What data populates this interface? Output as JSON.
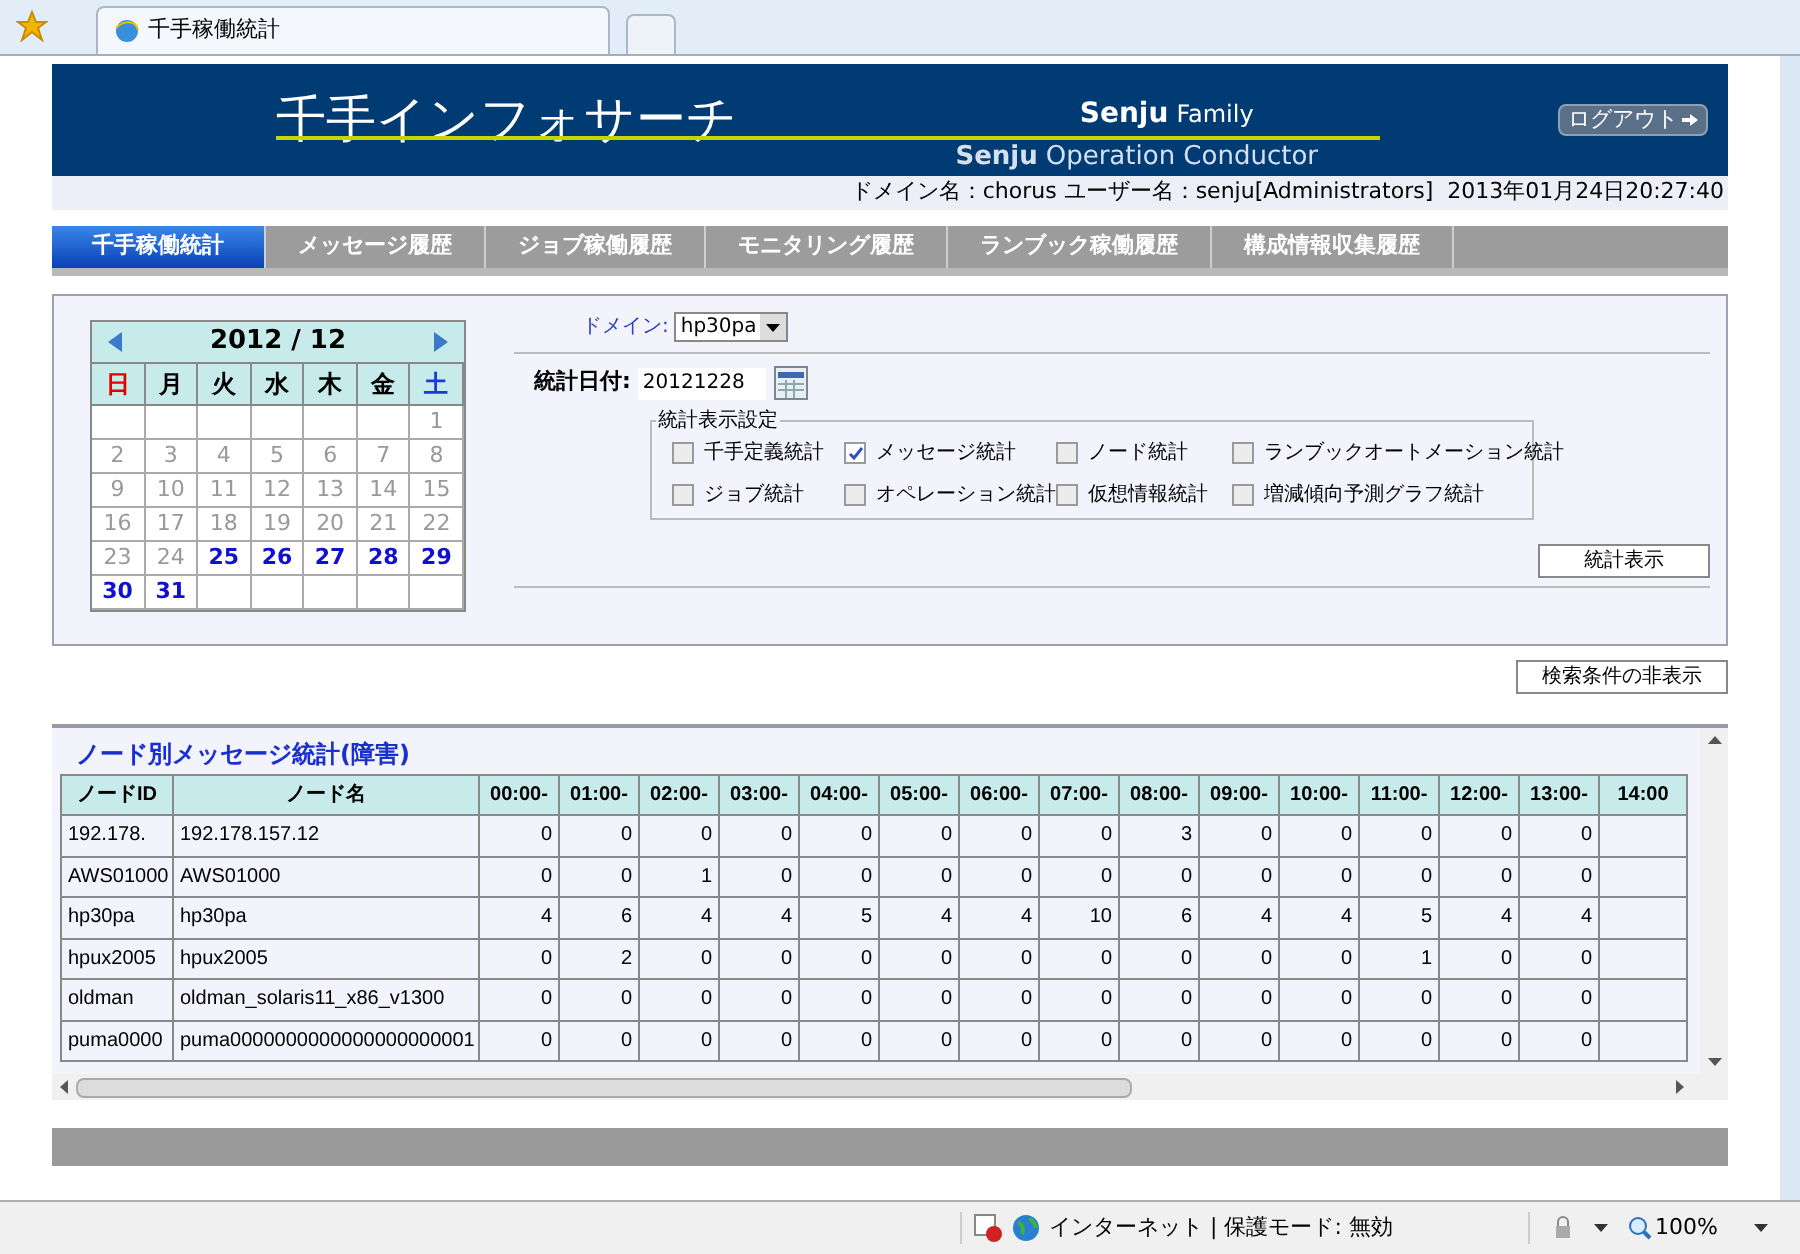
{
  "browser": {
    "tab_title": "千手稼働統計",
    "zone": "インターネット | 保護モード: 無効",
    "zoom": "100%"
  },
  "header": {
    "title": "千手インフォサーチ",
    "brand_top": "Senju",
    "brand_family": "Family",
    "brand_bottom_bold": "Senju",
    "brand_bottom": "Operation Conductor",
    "logout": "ログアウト"
  },
  "info": "ドメイン名：chorus ユーザー名：senju[Administrators]  2013年01月24日20:27:40",
  "tabs": [
    {
      "label": "千手稼働統計",
      "selected": true
    },
    {
      "label": "メッセージ履歴",
      "selected": false
    },
    {
      "label": "ジョブ稼働履歴",
      "selected": false
    },
    {
      "label": "モニタリング履歴",
      "selected": false
    },
    {
      "label": "ランブック稼働履歴",
      "selected": false
    },
    {
      "label": "構成情報収集履歴",
      "selected": false
    }
  ],
  "calendar": {
    "title": "2012 / 12",
    "weekdays": [
      {
        "label": "日",
        "kind": "sunday"
      },
      {
        "label": "月",
        "kind": "weekday"
      },
      {
        "label": "火",
        "kind": "weekday"
      },
      {
        "label": "水",
        "kind": "weekday"
      },
      {
        "label": "木",
        "kind": "weekday"
      },
      {
        "label": "金",
        "kind": "weekday"
      },
      {
        "label": "土",
        "kind": "saturday"
      }
    ],
    "weeks": [
      [
        {
          "kind": "blank"
        },
        {
          "kind": "blank"
        },
        {
          "kind": "blank"
        },
        {
          "kind": "blank"
        },
        {
          "kind": "blank"
        },
        {
          "kind": "blank"
        },
        {
          "kind": "day",
          "day": "1",
          "active": false
        }
      ],
      [
        {
          "day": "2",
          "active": false
        },
        {
          "day": "3",
          "active": false
        },
        {
          "day": "4",
          "active": false
        },
        {
          "day": "5",
          "active": false
        },
        {
          "day": "6",
          "active": false
        },
        {
          "day": "7",
          "active": false
        },
        {
          "day": "8",
          "active": false
        }
      ],
      [
        {
          "day": "9",
          "active": false
        },
        {
          "day": "10",
          "active": false
        },
        {
          "day": "11",
          "active": false
        },
        {
          "day": "12",
          "active": false
        },
        {
          "day": "13",
          "active": false
        },
        {
          "day": "14",
          "active": false
        },
        {
          "day": "15",
          "active": false
        }
      ],
      [
        {
          "day": "16",
          "active": false
        },
        {
          "day": "17",
          "active": false
        },
        {
          "day": "18",
          "active": false
        },
        {
          "day": "19",
          "active": false
        },
        {
          "day": "20",
          "active": false
        },
        {
          "day": "21",
          "active": false
        },
        {
          "day": "22",
          "active": false
        }
      ],
      [
        {
          "day": "23",
          "active": false
        },
        {
          "day": "24",
          "active": false
        },
        {
          "day": "25",
          "active": true
        },
        {
          "day": "26",
          "active": true
        },
        {
          "day": "27",
          "active": true
        },
        {
          "day": "28",
          "active": true
        },
        {
          "day": "29",
          "active": true
        }
      ],
      [
        {
          "day": "30",
          "active": true
        },
        {
          "day": "31",
          "active": true
        },
        {
          "kind": "blank"
        },
        {
          "kind": "blank"
        },
        {
          "kind": "blank"
        },
        {
          "kind": "blank"
        },
        {
          "kind": "blank"
        }
      ]
    ]
  },
  "form": {
    "domain_label": "ドメイン:",
    "domain_value": "hp30pa",
    "date_label": "統計日付:",
    "date_value": "20121228",
    "settings_legend": "統計表示設定",
    "options": [
      {
        "label": "千手定義統計",
        "checked": false
      },
      {
        "label": "メッセージ統計",
        "checked": true
      },
      {
        "label": "ノード統計",
        "checked": false
      },
      {
        "label": "ランブックオートメーション統計",
        "checked": false
      },
      {
        "label": "ジョブ統計",
        "checked": false
      },
      {
        "label": "オペレーション統計",
        "checked": false
      },
      {
        "label": "仮想情報統計",
        "checked": false
      },
      {
        "label": "増減傾向予測グラフ統計",
        "checked": false
      }
    ],
    "submit": "統計表示"
  },
  "toggle_button": "検索条件の非表示",
  "table": {
    "title": "ノード別メッセージ統計(障害)",
    "columns": [
      "ノードID",
      "ノード名",
      "00:00-",
      "01:00-",
      "02:00-",
      "03:00-",
      "04:00-",
      "05:00-",
      "06:00-",
      "07:00-",
      "08:00-",
      "09:00-",
      "10:00-",
      "11:00-",
      "12:00-",
      "13:00-",
      "14:00"
    ],
    "rows": [
      [
        "192.178.",
        "192.178.157.12",
        "0",
        "0",
        "0",
        "0",
        "0",
        "0",
        "0",
        "0",
        "3",
        "0",
        "0",
        "0",
        "0",
        "0"
      ],
      [
        "AWS01000",
        "AWS01000",
        "0",
        "0",
        "1",
        "0",
        "0",
        "0",
        "0",
        "0",
        "0",
        "0",
        "0",
        "0",
        "0",
        "0"
      ],
      [
        "hp30pa",
        "hp30pa",
        "4",
        "6",
        "4",
        "4",
        "5",
        "4",
        "4",
        "10",
        "6",
        "4",
        "4",
        "5",
        "4",
        "4"
      ],
      [
        "hpux2005",
        "hpux2005",
        "0",
        "2",
        "0",
        "0",
        "0",
        "0",
        "0",
        "0",
        "0",
        "0",
        "0",
        "1",
        "0",
        "0"
      ],
      [
        "oldman",
        "oldman_solaris11_x86_v1300",
        "0",
        "0",
        "0",
        "0",
        "0",
        "0",
        "0",
        "0",
        "0",
        "0",
        "0",
        "0",
        "0",
        "0"
      ],
      [
        "puma0000",
        "puma0000000000000000000001",
        "0",
        "0",
        "0",
        "0",
        "0",
        "0",
        "0",
        "0",
        "0",
        "0",
        "0",
        "0",
        "0",
        "0"
      ]
    ]
  }
}
